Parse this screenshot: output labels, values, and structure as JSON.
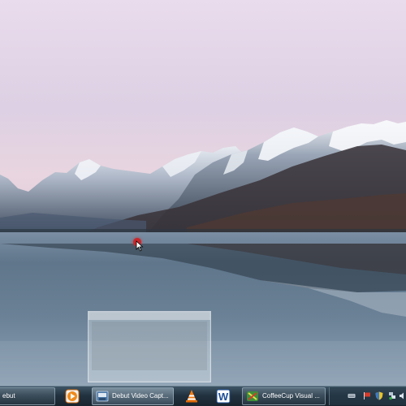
{
  "taskbar": {
    "items": [
      {
        "label": "ebut",
        "icon": "debut-app-icon"
      },
      {
        "label": "",
        "icon": "media-player-icon"
      },
      {
        "label": "Debut Video Capt...",
        "icon": "debut-video-capture-icon"
      },
      {
        "label": "",
        "icon": "vlc-cone-icon"
      },
      {
        "label": "",
        "icon": "word-icon"
      },
      {
        "label": "CoffeeCup Visual ...",
        "icon": "coffeecup-icon"
      }
    ]
  },
  "tray": {
    "icons": [
      "keyboard-icon",
      "flag-icon",
      "shield-icon",
      "network-icon",
      "volume-icon"
    ]
  },
  "colors": {
    "taskbar_top": "#3e5566",
    "taskbar_bottom": "#18242e",
    "cursor_marker": "#c8262b",
    "sky_top": "#e4d8ea",
    "water": "#5d7385"
  }
}
